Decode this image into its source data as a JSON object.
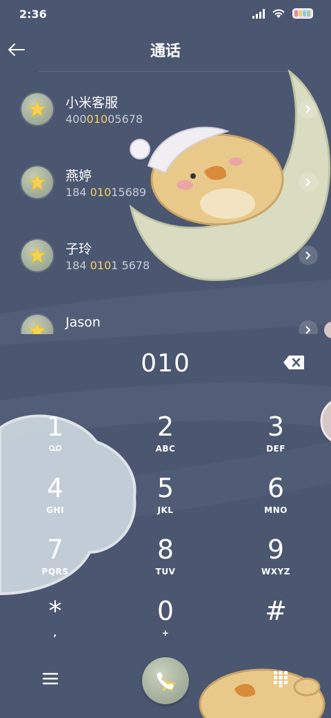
{
  "status_bar": {
    "time": "2:36"
  },
  "header": {
    "title": "通话"
  },
  "contacts": [
    {
      "name": "小米客服",
      "number_parts": [
        "400",
        "010",
        "05678"
      ]
    },
    {
      "name": "燕婷",
      "number_parts": [
        "184 ",
        "010",
        "15689"
      ]
    },
    {
      "name": "子玲",
      "number_parts": [
        "184 ",
        "010",
        "1 5678"
      ]
    },
    {
      "name": "Jason",
      "number_parts": [
        "",
        "",
        ""
      ]
    }
  ],
  "dialer": {
    "input": "010",
    "keys": [
      {
        "num": "1",
        "sub": ""
      },
      {
        "num": "2",
        "sub": "ABC"
      },
      {
        "num": "3",
        "sub": "DEF"
      },
      {
        "num": "4",
        "sub": "GHI"
      },
      {
        "num": "5",
        "sub": "JKL"
      },
      {
        "num": "6",
        "sub": "MNO"
      },
      {
        "num": "7",
        "sub": "PQRS"
      },
      {
        "num": "8",
        "sub": "TUV"
      },
      {
        "num": "9",
        "sub": "WXYZ"
      },
      {
        "num": "*",
        "sub": ","
      },
      {
        "num": "0",
        "sub": "+"
      },
      {
        "num": "#",
        "sub": ""
      }
    ]
  },
  "icons": {
    "back": "arrow-left-icon",
    "chevron": "chevron-right-icon",
    "backspace": "backspace-icon",
    "voicemail": "voicemail-icon",
    "menu": "menu-icon",
    "call": "phone-icon",
    "dialpad": "dialpad-icon"
  },
  "colors": {
    "background": "#4b5670",
    "highlight": "#f3d46a",
    "avatar": "#9aa592"
  }
}
